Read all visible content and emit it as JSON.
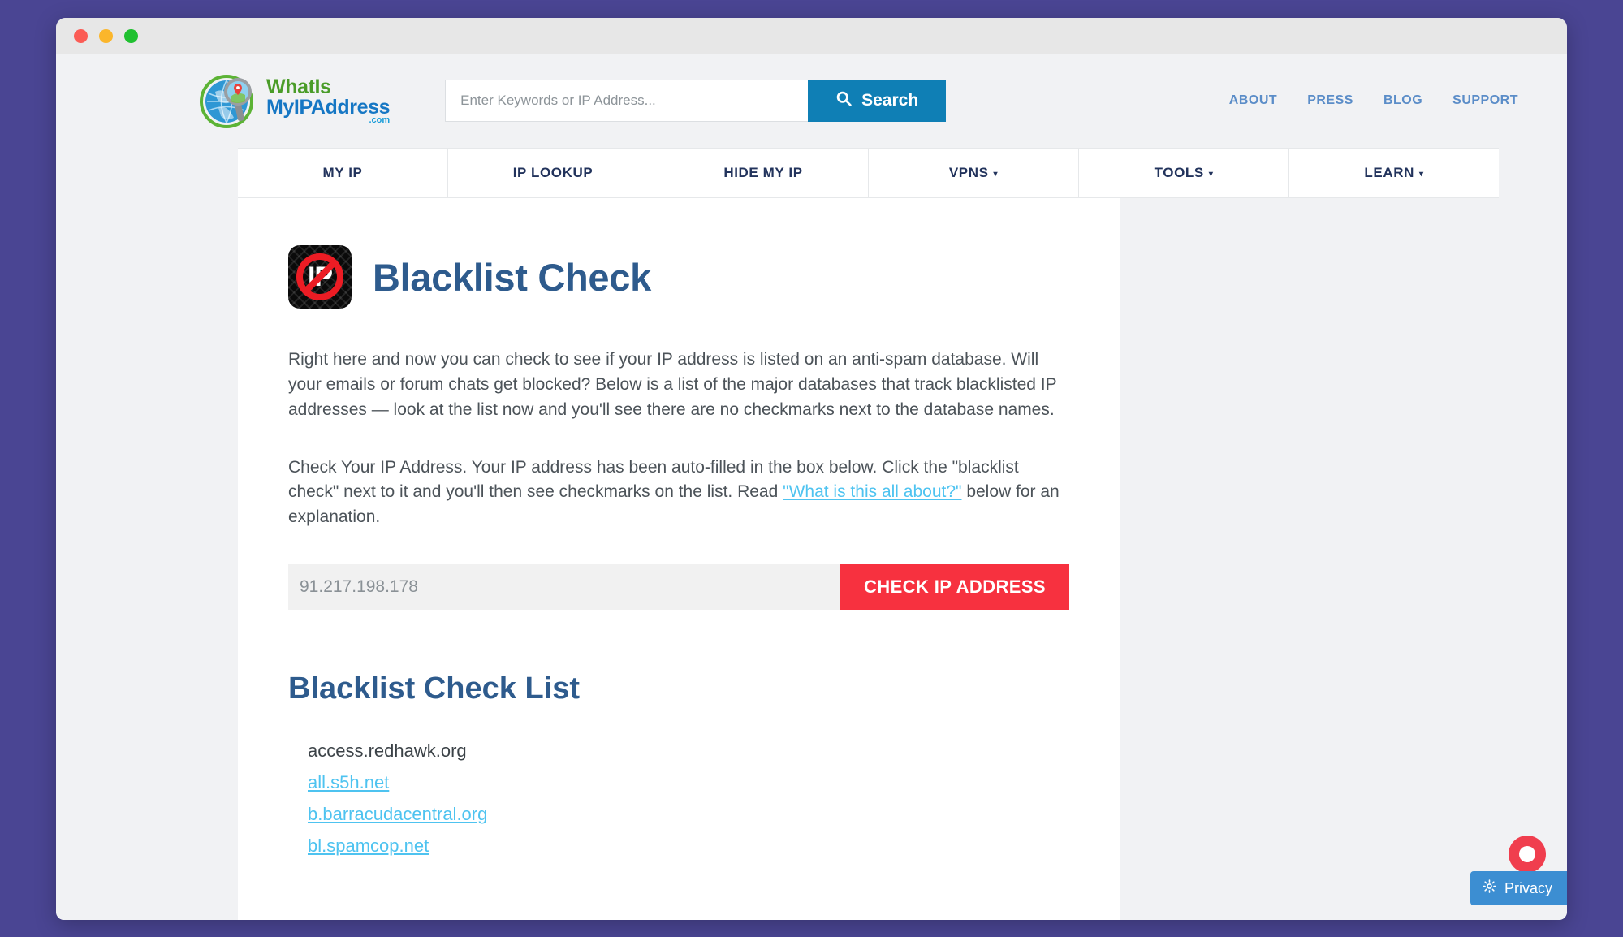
{
  "window": {
    "traffic_lights": [
      "close",
      "minimize",
      "maximize"
    ]
  },
  "header": {
    "logo": {
      "line1": "WhatIs",
      "line2": "MyIPAddress",
      "line3": ".com",
      "icon": "globe-magnifier-icon"
    },
    "search": {
      "placeholder": "Enter Keywords or IP Address...",
      "value": "",
      "button_label": "Search",
      "button_icon": "search-icon",
      "button_color": "#0f7fb5"
    },
    "utility_nav": [
      {
        "label": "ABOUT"
      },
      {
        "label": "PRESS"
      },
      {
        "label": "BLOG"
      },
      {
        "label": "SUPPORT"
      }
    ]
  },
  "mainnav": [
    {
      "label": "MY IP",
      "caret": ""
    },
    {
      "label": "IP LOOKUP",
      "caret": ""
    },
    {
      "label": "HIDE MY IP",
      "caret": ""
    },
    {
      "label": "VPNS",
      "caret": "▾"
    },
    {
      "label": "TOOLS",
      "caret": "▾"
    },
    {
      "label": "LEARN",
      "caret": "▾"
    }
  ],
  "main": {
    "icon_name": "blacklist-ip-icon",
    "icon_text": "IP",
    "title": "Blacklist Check",
    "paragraph1": "Right here and now you can check to see if your IP address is listed on an anti-spam database. Will your emails or forum chats get blocked? Below is a list of the major databases that track blacklisted IP addresses — look at the list now and you'll see there are no checkmarks next to the database names.",
    "paragraph2_before": "Check Your IP Address. Your IP address has been auto-filled in the box below. Click the \"blacklist check\" next to it and you'll then see checkmarks on the list. Read ",
    "paragraph2_link": "\"What is this all about?\"",
    "paragraph2_after": " below for an explanation.",
    "ip_input": {
      "value": "91.217.198.178",
      "placeholder": "91.217.198.178"
    },
    "check_button_label": "CHECK IP ADDRESS",
    "check_button_color": "#f7313f",
    "list_title": "Blacklist Check List",
    "list_items": [
      {
        "label": "access.redhawk.org",
        "is_link": false
      },
      {
        "label": "all.s5h.net",
        "is_link": true
      },
      {
        "label": "b.barracudacentral.org",
        "is_link": true
      },
      {
        "label": "bl.spamcop.net",
        "is_link": true
      }
    ]
  },
  "widgets": {
    "privacy_label": "Privacy",
    "privacy_icon": "gear-icon",
    "chat_icon": "chat-bubble-icon"
  },
  "colors": {
    "desktop_background": "#4a4593",
    "page_background": "#f1f2f4",
    "heading_blue": "#2e5b8d",
    "link_cyan": "#4ec3f0",
    "nav_text": "#22335c"
  }
}
